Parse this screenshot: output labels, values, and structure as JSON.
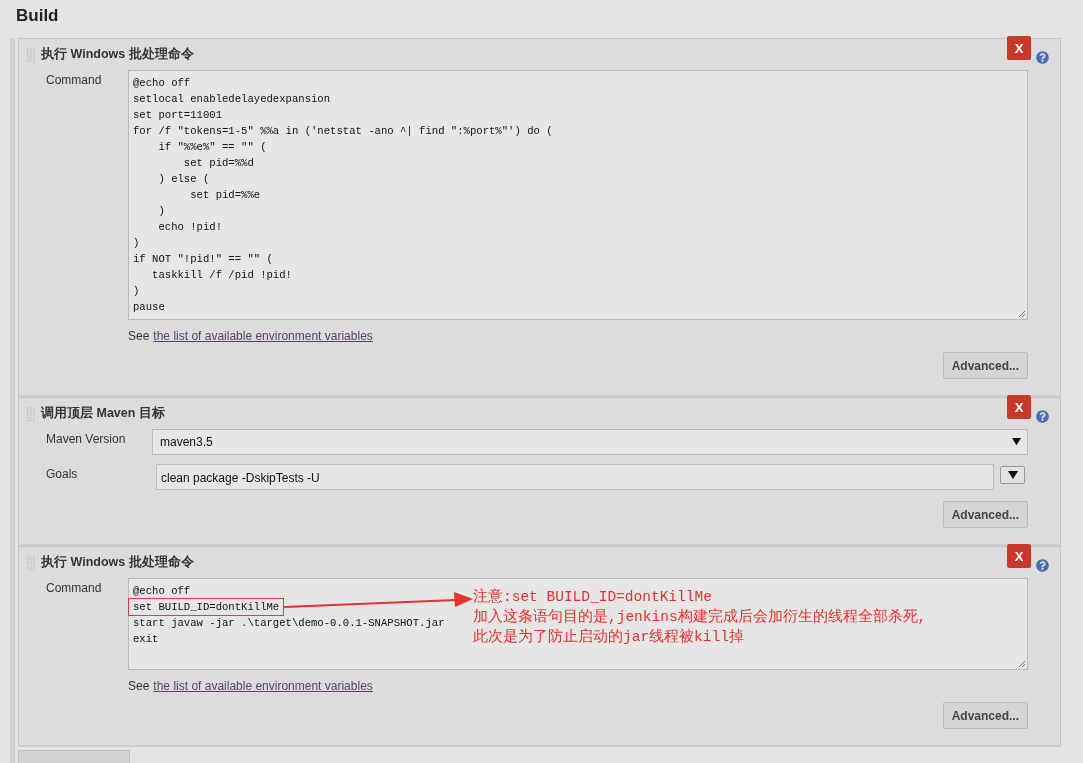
{
  "heading": "Build",
  "steps": [
    {
      "kind": "batch",
      "title": "执行 Windows 批处理命令",
      "command_label": "Command",
      "delete_button": "X",
      "hint_prefix": "See",
      "hint_link": "the list of available environment variables",
      "advanced_button": "Advanced...",
      "command_lines": [
        {
          "text": "@echo off",
          "highlighted": false
        },
        {
          "text": "setlocal enabledelayedexpansion",
          "highlighted": false
        },
        {
          "text": "set port=11001",
          "highlighted": false
        },
        {
          "text": "for /f \"tokens=1-5\" %%a in ('netstat -ano ^| find \":%port%\"') do (",
          "highlighted": false
        },
        {
          "text": "    if \"%%e%\" == \"\" (",
          "highlighted": false
        },
        {
          "text": "        set pid=%%d",
          "highlighted": false
        },
        {
          "text": "    ) else (",
          "highlighted": false
        },
        {
          "text": "         set pid=%%e",
          "highlighted": false
        },
        {
          "text": "    )",
          "highlighted": false
        },
        {
          "text": "    echo !pid!",
          "highlighted": false
        },
        {
          "text": ")",
          "highlighted": false
        },
        {
          "text": "if NOT \"!pid!\" == \"\" (",
          "highlighted": false
        },
        {
          "text": "   taskkill /f /pid !pid!",
          "highlighted": false
        },
        {
          "text": ")",
          "highlighted": false
        },
        {
          "text": "pause",
          "highlighted": false
        }
      ]
    },
    {
      "kind": "maven",
      "title": "调用顶层 Maven 目标",
      "delete_button": "X",
      "version_label": "Maven Version",
      "version_value": "maven3.5",
      "goals_label": "Goals",
      "goals_value": "clean package -DskipTests -U",
      "advanced_button": "Advanced..."
    },
    {
      "kind": "batch",
      "title": "执行 Windows 批处理命令",
      "command_label": "Command",
      "delete_button": "X",
      "hint_prefix": "See",
      "hint_link": "the list of available environment variables",
      "advanced_button": "Advanced...",
      "command_lines": [
        {
          "text": "@echo off",
          "highlighted": false
        },
        {
          "text": "set BUILD_ID=dontKillMe",
          "highlighted": true
        },
        {
          "text": "start javaw -jar .\\target\\demo-0.0.1-SNAPSHOT.jar",
          "highlighted": false
        },
        {
          "text": "exit",
          "highlighted": false
        }
      ],
      "annotation": {
        "lines": [
          "注意:set BUILD_ID=dontKillMe",
          "加入这条语句目的是,jenkins构建完成后会加衍生的线程全部杀死,",
          "此次是为了防止启动的jar线程被kill掉"
        ]
      }
    }
  ]
}
